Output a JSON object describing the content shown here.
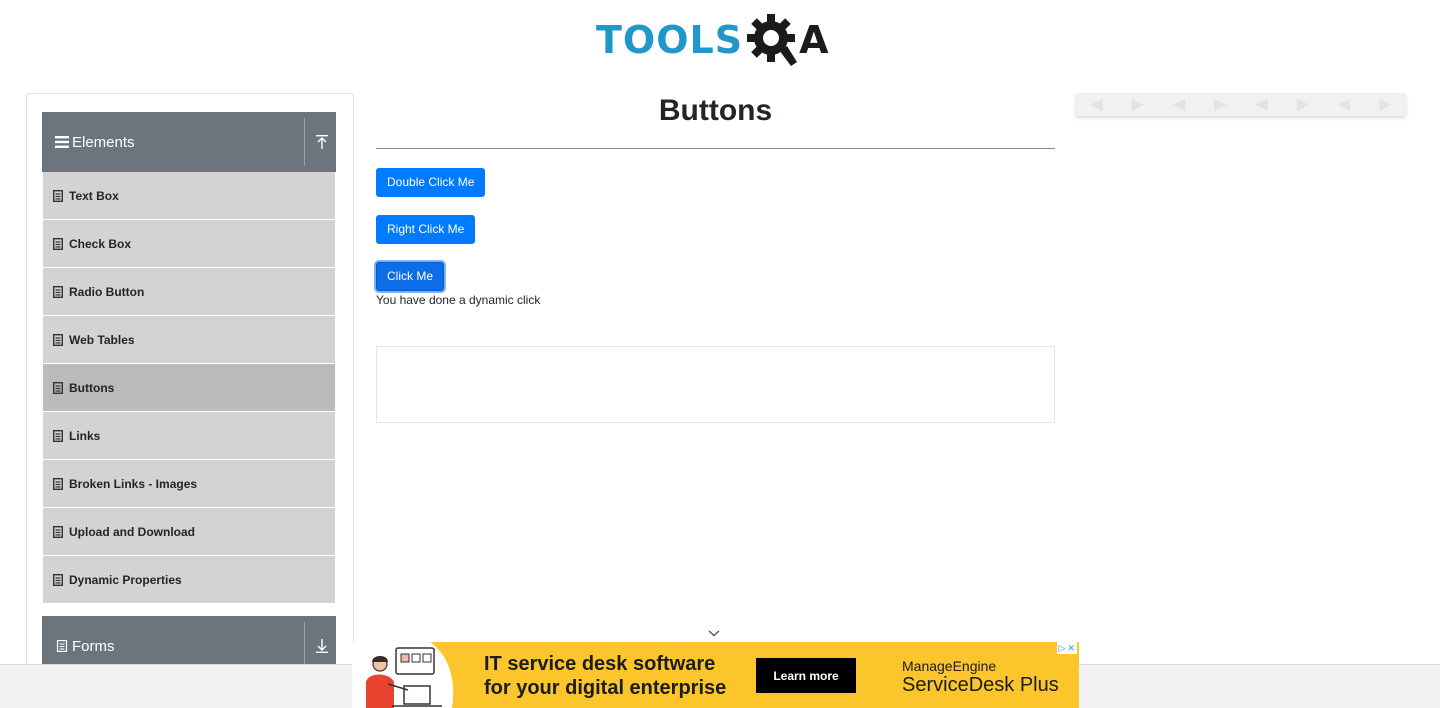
{
  "header": {
    "logo_text": "TOOLS",
    "logo_suffix": "A",
    "logo_icon": "gear-q-icon",
    "colors": {
      "logo_blue": "#1f97c9",
      "logo_dark": "#1b1b1b"
    }
  },
  "sidebar": {
    "groups": [
      {
        "title": "Elements",
        "icon": "bars-icon",
        "arrow": "arrow-up-icon",
        "expanded": true
      },
      {
        "title": "Forms",
        "icon": "document-icon",
        "arrow": "arrow-down-icon",
        "expanded": false
      }
    ],
    "items": [
      {
        "label": "Text Box"
      },
      {
        "label": "Check Box"
      },
      {
        "label": "Radio Button"
      },
      {
        "label": "Web Tables"
      },
      {
        "label": "Buttons",
        "active": true
      },
      {
        "label": "Links"
      },
      {
        "label": "Broken Links - Images"
      },
      {
        "label": "Upload and Download"
      },
      {
        "label": "Dynamic Properties"
      }
    ],
    "colors": {
      "group_bg": "#6c757d",
      "item_bg": "#d3d3d3",
      "active_bg": "#bbbbbb"
    }
  },
  "main": {
    "title": "Buttons",
    "buttons": {
      "double_click": "Double Click Me",
      "right_click": "Right Click Me",
      "click": "Click Me"
    },
    "message": "You have done a dynamic click",
    "colors": {
      "button_primary": "#007bff"
    }
  },
  "ad_banner": {
    "headline_line1": "IT service desk software",
    "headline_line2": "for your digital enterprise",
    "cta": "Learn more",
    "brand_top": "ManageEngine",
    "brand_bottom": "ServiceDesk Plus",
    "colors": {
      "background": "#fcc52c"
    }
  }
}
